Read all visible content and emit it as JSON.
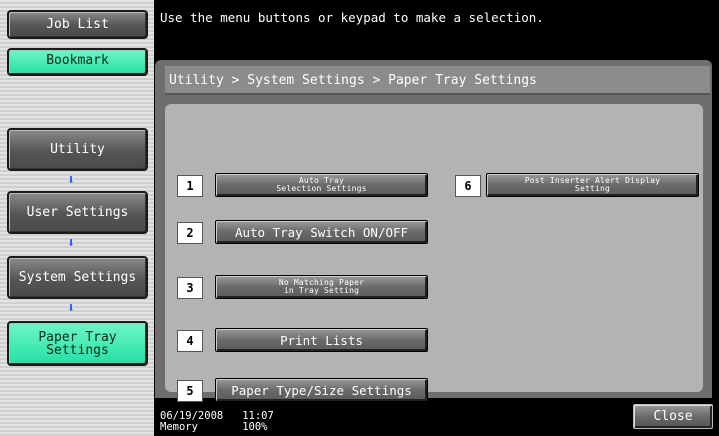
{
  "sidebar": {
    "job_list": "Job List",
    "bookmark": "Bookmark",
    "path": [
      {
        "label": "Utility"
      },
      {
        "label": "User Settings"
      },
      {
        "label": "System Settings"
      },
      {
        "label": "Paper Tray\nSettings"
      }
    ],
    "arrow_glyph": "⬇",
    "colors": {
      "active": "#3be8b0",
      "arrow": "#1a55ff"
    }
  },
  "message": "Use the menu buttons or keypad to make a selection.",
  "breadcrumb": "Utility > System Settings > Paper Tray Settings",
  "options": [
    {
      "num": "1",
      "label": "Auto Tray\nSelection Settings"
    },
    {
      "num": "2",
      "label": "Auto Tray Switch ON/OFF"
    },
    {
      "num": "3",
      "label": "No Matching Paper\nin Tray Setting"
    },
    {
      "num": "4",
      "label": "Print Lists"
    },
    {
      "num": "5",
      "label": "Paper Type/Size Settings"
    },
    {
      "num": "6",
      "label": "Post Inserter Alert Display\nSetting"
    }
  ],
  "footer": {
    "date": "06/19/2008",
    "time": "11:07",
    "memory_label": "Memory",
    "memory_value": "100%",
    "close": "Close"
  }
}
